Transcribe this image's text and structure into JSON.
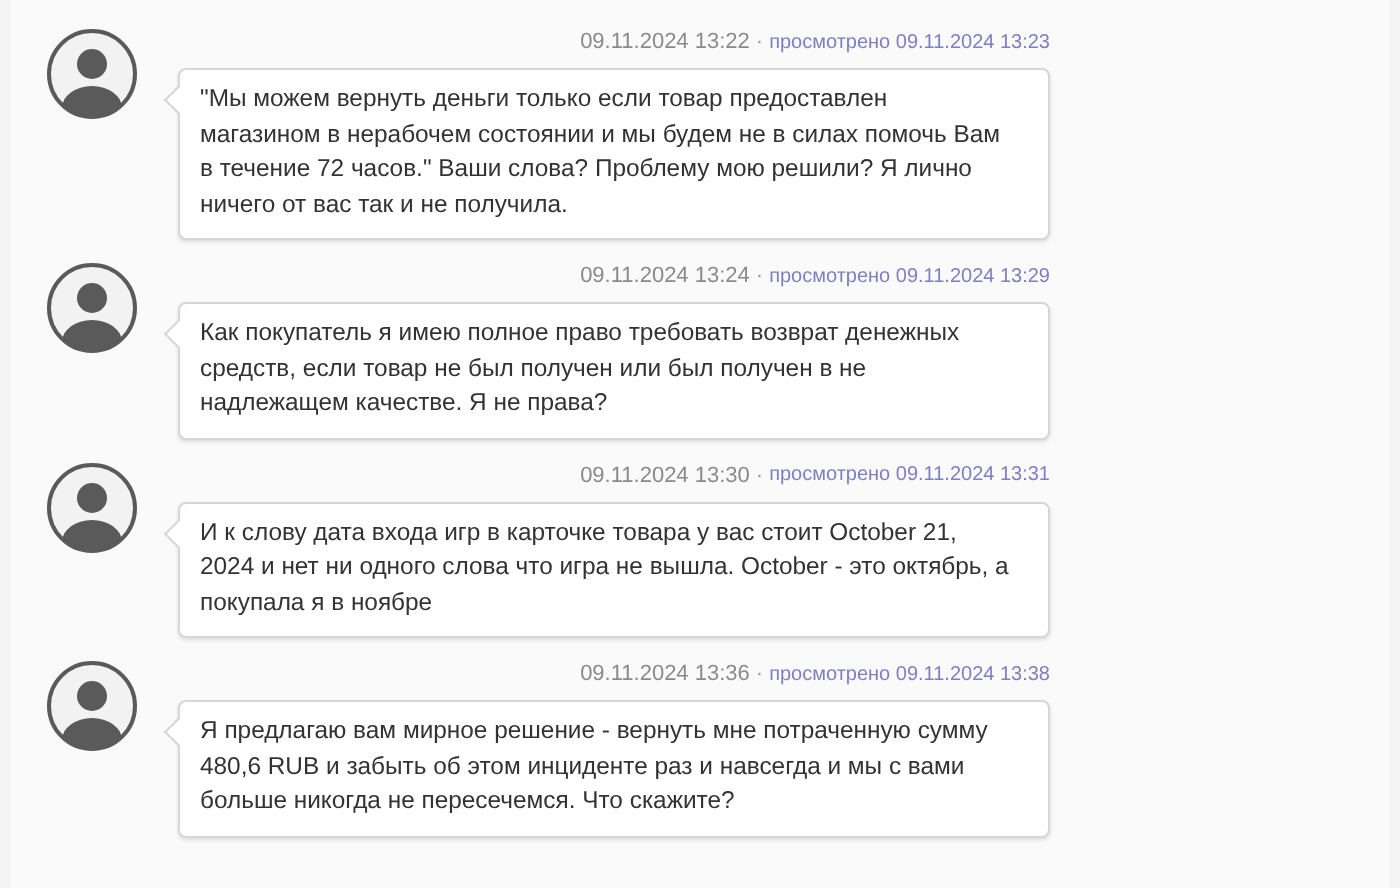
{
  "messages": [
    {
      "time": "09.11.2024 13:22",
      "separator": "·",
      "seen": "просмотрено 09.11.2024 13:23",
      "text": "\"Мы можем вернуть деньги только если товар предоставлен\nмагазином в нерабочем состоянии и мы будем не в силах помочь Вам\nв течение 72 часов.\" Ваши слова? Проблему мою решили? Я лично\nничего от вас так и не получила."
    },
    {
      "time": "09.11.2024 13:24",
      "separator": "·",
      "seen": "просмотрено 09.11.2024 13:29",
      "text": "Как покупатель я имею полное право требовать возврат денежных\nсредств, если товар не был получен или был получен в не\nнадлежащем качестве. Я не права?"
    },
    {
      "time": "09.11.2024 13:30",
      "separator": "·",
      "seen": "просмотрено 09.11.2024 13:31",
      "text": "И к слову дата входа игр в карточке товара у вас стоит October 21,\n2024 и нет ни одного слова что игра не вышла. October - это октябрь, а\nпокупала я в ноябре"
    },
    {
      "time": "09.11.2024 13:36",
      "separator": "·",
      "seen": "просмотрено 09.11.2024 13:38",
      "text": "Я предлагаю вам мирное решение - вернуть мне потраченную сумму\n480,6 RUB и забыть об этом инциденте раз и навсегда и мы с вами\nбольше никогда не пересечемся. Что скажите?"
    }
  ]
}
